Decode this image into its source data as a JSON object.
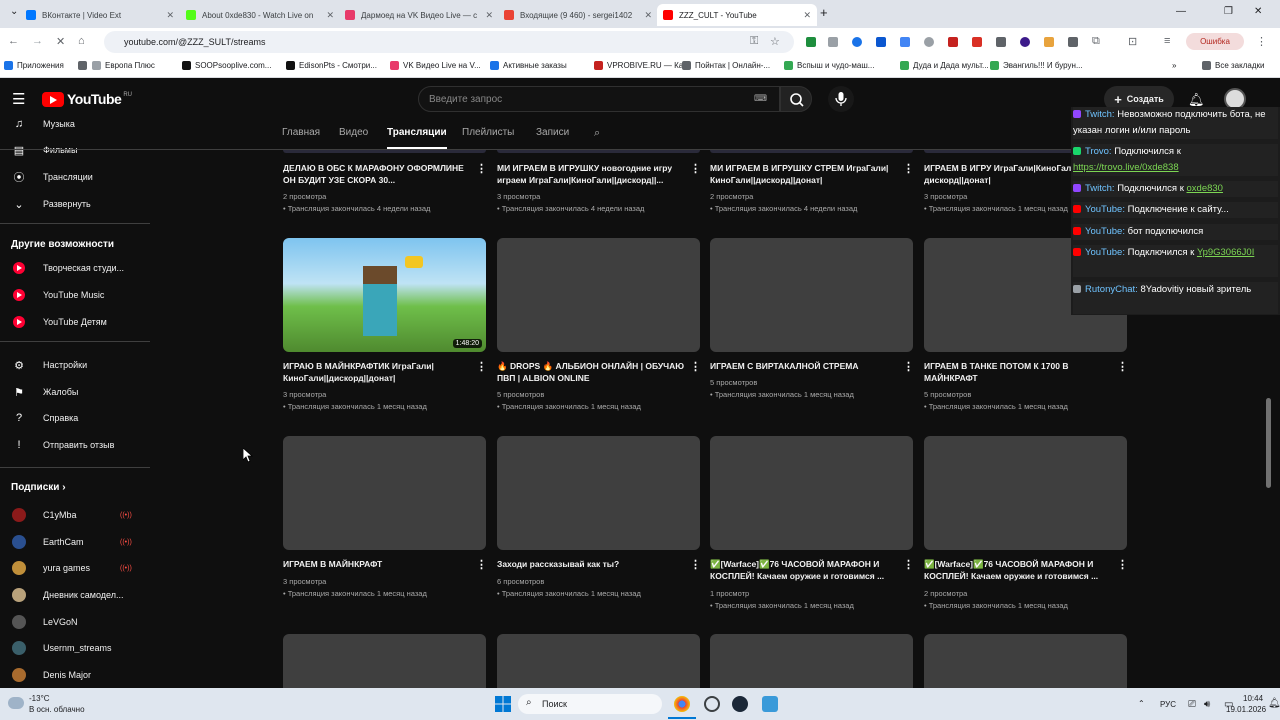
{
  "browser": {
    "tabs": [
      {
        "title": "ВКонтакте | Video Ext",
        "icon": "vk-icon",
        "color": "#0077ff",
        "active": false
      },
      {
        "title": "About 0xde830 - Watch Live on",
        "icon": "kick-icon",
        "color": "#53fc18",
        "active": false
      },
      {
        "title": "Дармоед на VK Видео Live — с",
        "icon": "vk-video-icon",
        "color": "#e83a6a",
        "active": false
      },
      {
        "title": "Входящие (9 460) - sergei1402",
        "icon": "gmail-icon",
        "color": "#ea4335",
        "active": false
      },
      {
        "title": "ZZZ_CULT - YouTube",
        "icon": "youtube-icon",
        "color": "#ff0000",
        "active": true
      }
    ],
    "new_tab": "+",
    "url": "youtube.com/@ZZZ_SULT/streams",
    "error_label": "Ошибка",
    "bookmarks": [
      {
        "label": "Приложения",
        "color": "#1a73e8"
      },
      {
        "label": "",
        "color": "#5f6368"
      },
      {
        "label": "Европа Плюс",
        "color": "#9aa0a6"
      },
      {
        "label": "SOOPsooplive.com...",
        "color": "#111111"
      },
      {
        "label": "EdisonPts - Смотри...",
        "color": "#111111"
      },
      {
        "label": "VK Видео Live на V...",
        "color": "#e83a6a"
      },
      {
        "label": "Активные заказы",
        "color": "#1a73e8"
      },
      {
        "label": "VPROBIVE.RU — Ка...",
        "color": "#c5221f"
      },
      {
        "label": "Пойнтак | Онлайн-...",
        "color": "#5f6368"
      },
      {
        "label": "Вспыш и чудо-маш...",
        "color": "#34a853"
      },
      {
        "label": "Дуда и Дада мульт...",
        "color": "#34a853"
      },
      {
        "label": "Эвангиль!!! И бурун...",
        "color": "#34a853"
      }
    ],
    "all_bookmarks": "Все закладки"
  },
  "youtube": {
    "logo_text": "YouTube",
    "logo_region": "RU",
    "search_placeholder": "Введите запрос",
    "create_label": "Создать",
    "sidebar": {
      "top": [
        {
          "label": "Музыка",
          "icon": "music-icon"
        },
        {
          "label": "Фильмы",
          "icon": "film-icon"
        },
        {
          "label": "Трансляции",
          "icon": "live-icon"
        },
        {
          "label": "Развернуть",
          "icon": "chevron-down-icon"
        }
      ],
      "more_heading": "Другие возможности",
      "more": [
        {
          "label": "Творческая студи...",
          "icon": "studio-icon"
        },
        {
          "label": "YouTube Music",
          "icon": "youtube-music-icon"
        },
        {
          "label": "YouTube Детям",
          "icon": "youtube-kids-icon"
        }
      ],
      "settings": [
        {
          "label": "Настройки",
          "icon": "gear-icon"
        },
        {
          "label": "Жалобы",
          "icon": "flag-icon"
        },
        {
          "label": "Справка",
          "icon": "help-icon"
        },
        {
          "label": "Отправить отзыв",
          "icon": "feedback-icon"
        }
      ],
      "subs_heading": "Подписки",
      "subs": [
        {
          "label": "C1yMba",
          "live": true,
          "color": "#8b1a1a"
        },
        {
          "label": "EarthCam",
          "live": true,
          "color": "#2a4f8f"
        },
        {
          "label": "yura games",
          "live": true,
          "color": "#c08f3a"
        },
        {
          "label": "Дневник самодел...",
          "live": false,
          "color": "#b9a27b"
        },
        {
          "label": "LeVGoN",
          "live": false,
          "color": "#555555"
        },
        {
          "label": "Usernm_streams",
          "live": false,
          "color": "#3a5f6a"
        },
        {
          "label": "Denis Major",
          "live": false,
          "color": "#a86b2e"
        }
      ],
      "live_symbol": "((•))"
    },
    "channel_tabs": [
      {
        "label": "Главная",
        "active": false
      },
      {
        "label": "Видео",
        "active": false
      },
      {
        "label": "Трансляции",
        "active": true
      },
      {
        "label": "Плейлисты",
        "active": false
      },
      {
        "label": "Записи",
        "active": false
      }
    ],
    "videos_row0": [
      {
        "title": "ДЕЛАЮ В ОБС К МАРАФОНУ ОФОРМЛИНЕ ОН БУДИТ УЗЕ СКОРА 30...",
        "views": "2 просмотра",
        "ago": "• Трансляция закончилась 4 недели назад"
      },
      {
        "title": "МИ ИГРАЕМ В ИГРУШКУ новогодние игру играем ИграГали|КиноГали||дискорд||...",
        "views": "3 просмотра",
        "ago": "• Трансляция закончилась 4 недели назад"
      },
      {
        "title": "МИ ИГРАЕМ В ИГРУШКУ СТРЕМ ИграГали|КиноГали||дискорд||донат|",
        "views": "2 просмотра",
        "ago": "• Трансляция закончилась 4 недели назад"
      },
      {
        "title": "ИГРАЕМ В ИГРУ ИграГали|КиноГали|| дискорд||донат|",
        "views": "3 просмотра",
        "ago": "• Трансляция закончилась 1 месяц назад"
      }
    ],
    "videos_row1": [
      {
        "title": "ИГРАЮ В МАЙНКРАФТИК ИграГали| КиноГали||дискорд||донат|",
        "views": "3 просмотра",
        "ago": "• Трансляция закончилась 1 месяц назад",
        "duration": "1:48:20"
      },
      {
        "title": "🔥 DROPS 🔥 АЛЬБИОН ОНЛАЙН | ОБУЧАЮ ПВП | ALBION ONLINE",
        "views": "5 просмотров",
        "ago": "• Трансляция закончилась 1 месяц назад"
      },
      {
        "title": "ИГРАЕМ С ВИРТАКАЛНОЙ СТРЕМА",
        "views": "5 просмотров",
        "ago": "• Трансляция закончилась 1 месяц назад"
      },
      {
        "title": "ИГРАЕМ В ТАНКЕ ПОТОМ К 1700 В МАЙНКРАФТ",
        "views": "5 просмотров",
        "ago": "• Трансляция закончилась 1 месяц назад"
      }
    ],
    "videos_row2": [
      {
        "title": "ИГРАЕМ В МАЙНКРАФТ",
        "views": "3 просмотра",
        "ago": "• Трансляция закончилась 1 месяц назад"
      },
      {
        "title": "Заходи рассказывай как ты?",
        "views": "6 просмотров",
        "ago": "• Трансляция закончилась 1 месяц назад"
      },
      {
        "title": "✅[Warface]✅76 ЧАСОВОЙ МАРАФОН И КОСПЛЕЙ! Качаем оружие и готовимся ...",
        "views": "1 просмотр",
        "ago": "• Трансляция закончилась 1 месяц назад"
      },
      {
        "title": "✅[Warface]✅76 ЧАСОВОЙ МАРАФОН И КОСПЛЕЙ! Качаем оружие и готовимся ...",
        "views": "2 просмотра",
        "ago": "• Трансляция закончилась 1 месяц назад"
      }
    ]
  },
  "chat": [
    {
      "source": "Twitch:",
      "color": "#9146ff",
      "text": "Невозможно подключить бота, не указан логин и/или пароль",
      "link": ""
    },
    {
      "source": "Trovo:",
      "color": "#19d66b",
      "text": "Подключился к",
      "link": "https://trovo.live/0xde838"
    },
    {
      "source": "Twitch:",
      "color": "#9146ff",
      "text": "Подключился к",
      "link": "oxde830"
    },
    {
      "source": "YouTube:",
      "color": "#ff0000",
      "text": "Подключение к сайту...",
      "link": ""
    },
    {
      "source": "YouTube:",
      "color": "#ff0000",
      "text": "бот подключился",
      "link": ""
    },
    {
      "source": "YouTube:",
      "color": "#ff0000",
      "text": "Подключился к",
      "link": "Yp9G3066J0I"
    },
    {
      "source": "RutonyChat:",
      "color": "#9aa0a6",
      "text": "8Yadovitiy новый зритель",
      "link": ""
    }
  ],
  "taskbar": {
    "weather_temp": "-13°C",
    "weather_desc": "В осн. облачно",
    "search_label": "Поиск",
    "lang": "РУС",
    "time": "10:44",
    "date": "19.01.2026"
  }
}
